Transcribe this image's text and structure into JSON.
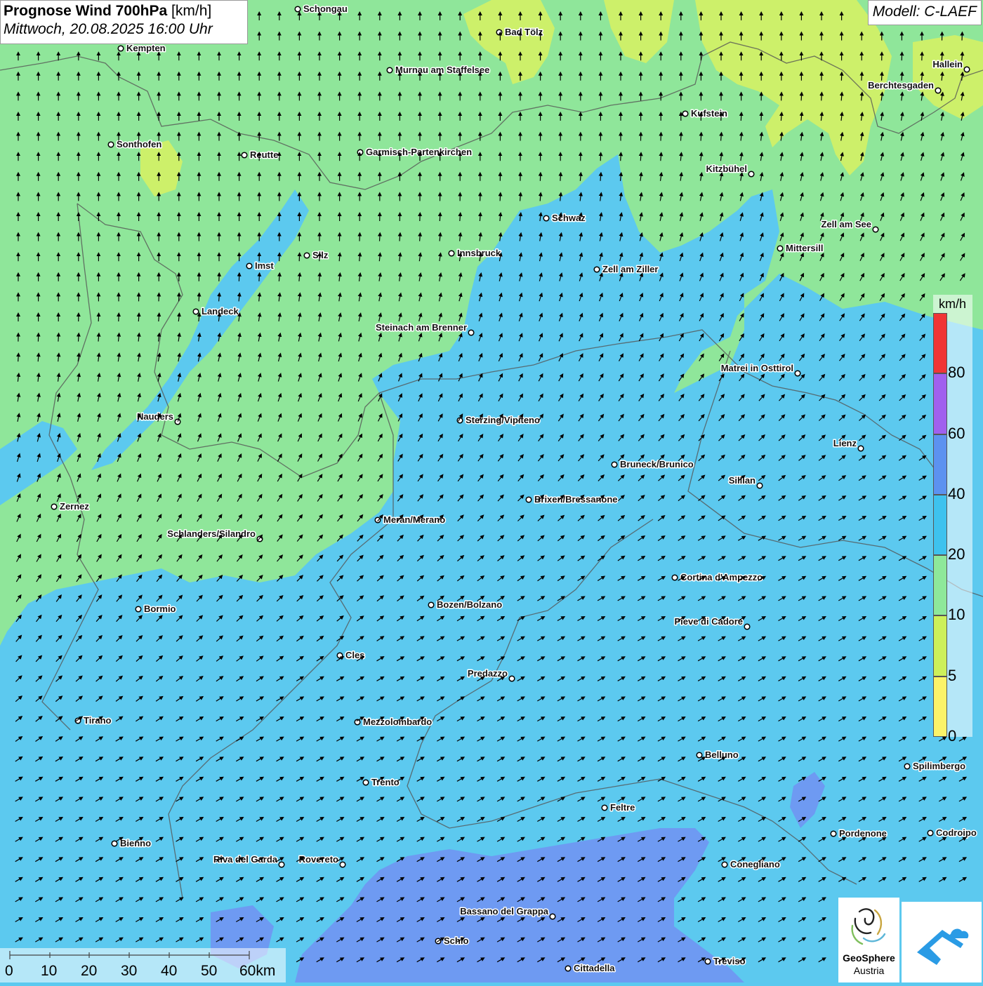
{
  "header": {
    "title_bold": "Prognose Wind 700hPa",
    "title_unit": "[km/h]",
    "datetime": "Mittwoch, 20.08.2025 16:00 Uhr",
    "model": "Modell: C-LAEF"
  },
  "legend": {
    "unit": "km/h",
    "bands": [
      {
        "label": "80",
        "color": "#f03535"
      },
      {
        "label": "60",
        "color": "#a060ee"
      },
      {
        "label": "40",
        "color": "#5c92f0"
      },
      {
        "label": "20",
        "color": "#3ec2ee"
      },
      {
        "label": "10",
        "color": "#8ee89a"
      },
      {
        "label": "5",
        "color": "#cdf05a"
      },
      {
        "label": "0",
        "color": "#fbf368"
      }
    ]
  },
  "scale": {
    "labels": [
      "0",
      "10",
      "20",
      "30",
      "40",
      "50",
      "60km"
    ]
  },
  "cities": [
    {
      "name": "Schongau"
    },
    {
      "name": "Bad Tölz"
    },
    {
      "name": "Kempten"
    },
    {
      "name": "Murnau am Staffelsee"
    },
    {
      "name": "Hallein"
    },
    {
      "name": "Berchtesgaden"
    },
    {
      "name": "Kufstein"
    },
    {
      "name": "Sonthofen"
    },
    {
      "name": "Reutte"
    },
    {
      "name": "Garmisch-Partenkirchen"
    },
    {
      "name": "Kitzbühel"
    },
    {
      "name": "Schwaz"
    },
    {
      "name": "Zell am See"
    },
    {
      "name": "Imst"
    },
    {
      "name": "Silz"
    },
    {
      "name": "Innsbruck"
    },
    {
      "name": "Mittersill"
    },
    {
      "name": "Zell am Ziller"
    },
    {
      "name": "Landeck"
    },
    {
      "name": "Steinach am Brenner"
    },
    {
      "name": "Matrei in Osttirol"
    },
    {
      "name": "Nauders"
    },
    {
      "name": "Sterzing/Vipiteno"
    },
    {
      "name": "Lienz"
    },
    {
      "name": "Bruneck/Brunico"
    },
    {
      "name": "Sillian"
    },
    {
      "name": "Brixen/Bressanone"
    },
    {
      "name": "Zernez"
    },
    {
      "name": "Meran/Merano"
    },
    {
      "name": "Schlanders/Silandro"
    },
    {
      "name": "Cortina d'Ampezzo"
    },
    {
      "name": "Bozen/Bolzano"
    },
    {
      "name": "Bormio"
    },
    {
      "name": "Pieve di Cadore"
    },
    {
      "name": "Cles"
    },
    {
      "name": "Predazzo"
    },
    {
      "name": "Tirano"
    },
    {
      "name": "Mezzolombardo"
    },
    {
      "name": "Belluno"
    },
    {
      "name": "Spilimbergo"
    },
    {
      "name": "Trento"
    },
    {
      "name": "Feltre"
    },
    {
      "name": "Pordenone"
    },
    {
      "name": "Codroipo"
    },
    {
      "name": "Bienno"
    },
    {
      "name": "Riva del Garda"
    },
    {
      "name": "Rovereto"
    },
    {
      "name": "Conegliano"
    },
    {
      "name": "Bassano del Grappa"
    },
    {
      "name": "Schio"
    },
    {
      "name": "Treviso"
    },
    {
      "name": "Cittadella"
    }
  ],
  "logos": {
    "geosphere_line1": "GeoSphere",
    "geosphere_line2": "Austria"
  }
}
